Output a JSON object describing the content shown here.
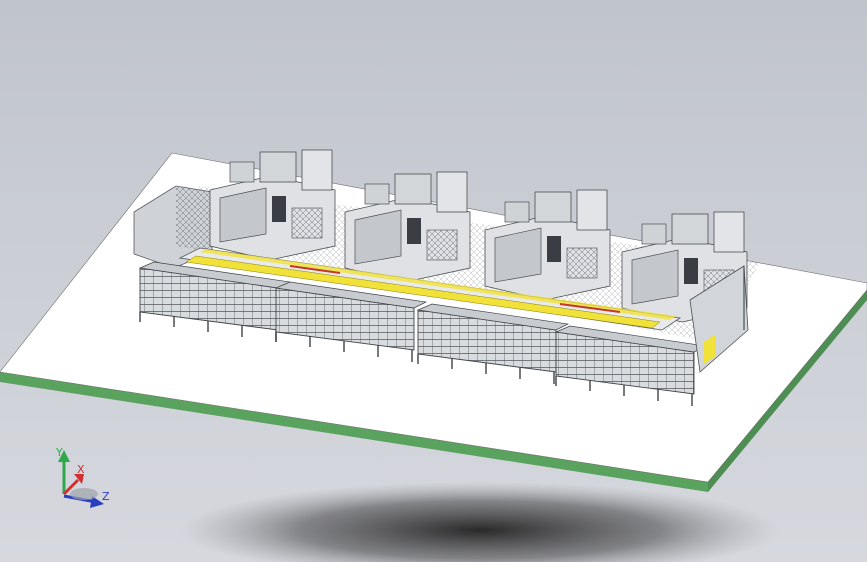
{
  "viewport": {
    "background_top": "#c0c4cb",
    "background_bottom": "#d6d8de",
    "floor_color": "#ffffff",
    "floor_edge_color": "#5aa35e",
    "accent_yellow": "#f1e23a",
    "accent_red": "#c0392b"
  },
  "model": {
    "machine_count": 4
  },
  "triad": {
    "y_label": "Y",
    "x_label": "X",
    "z_label": "Z",
    "y_color": "#2fa84a",
    "x_color": "#d03030",
    "z_color": "#2a3fc0"
  }
}
